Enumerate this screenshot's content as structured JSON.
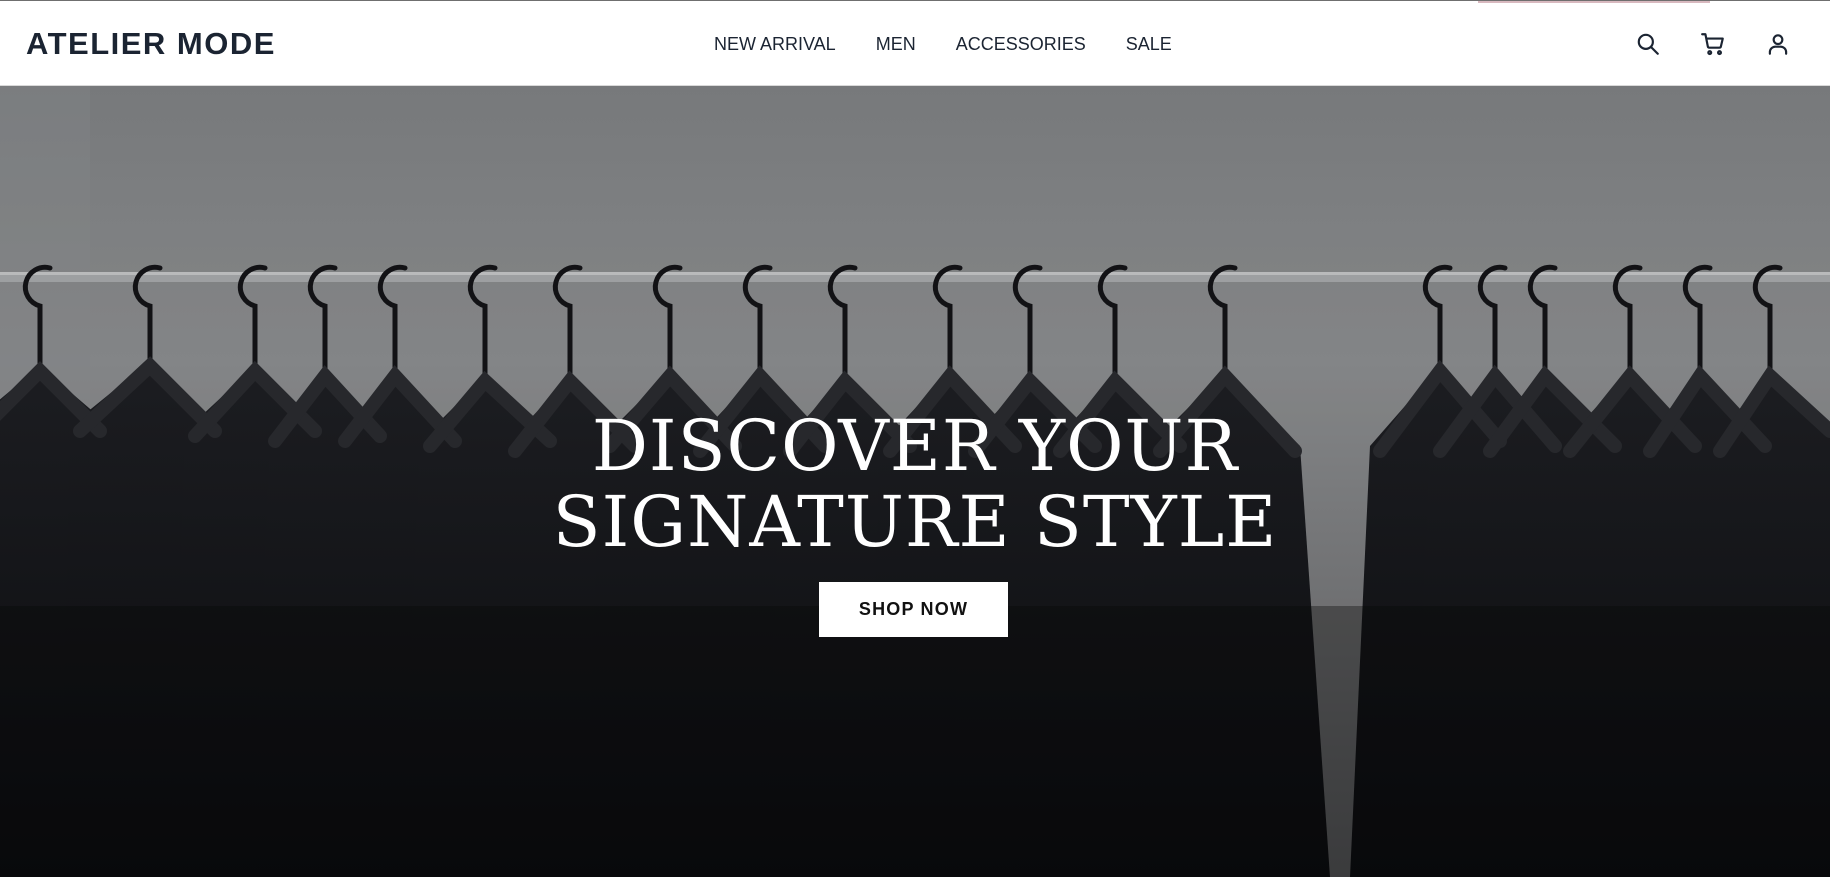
{
  "brand": {
    "logo_text": "ATELIER MODE"
  },
  "nav": {
    "items": [
      {
        "label": "NEW ARRIVAL"
      },
      {
        "label": "MEN"
      },
      {
        "label": "ACCESSORIES"
      },
      {
        "label": "SALE"
      }
    ]
  },
  "header_icons": {
    "search": "search-icon",
    "cart": "cart-icon",
    "account": "user-icon"
  },
  "hero": {
    "title_line1": "DISCOVER YOUR",
    "title_line2": "SIGNATURE STYLE",
    "cta_label": "SHOP NOW",
    "background_description_color": "#141416"
  },
  "colors": {
    "text_dark": "#1b2432",
    "header_bg": "#ffffff",
    "cta_bg": "#ffffff",
    "hero_dark": "#141416"
  }
}
